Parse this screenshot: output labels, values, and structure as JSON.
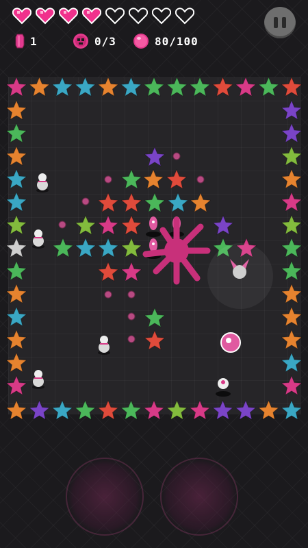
{
  "hud": {
    "hearts": [
      {
        "state": "full"
      },
      {
        "state": "full"
      },
      {
        "state": "full"
      },
      {
        "state": "full"
      },
      {
        "state": "empty"
      },
      {
        "state": "empty"
      },
      {
        "state": "empty"
      },
      {
        "state": "empty"
      }
    ],
    "gems": "1",
    "enemies": "0/3",
    "energy": "80/100",
    "colors": {
      "heart_full": "#f0318c",
      "heart_empty": "#1b1a1d",
      "gem": "#e23a8f",
      "energy": "#e43a8d",
      "pink": "#e05aa0"
    }
  },
  "star_colors": [
    "#d83a87",
    "#e6832f",
    "#3aa7c4",
    "#4bb75a",
    "#7a44c7",
    "#e04b3b",
    "#83bb3d",
    "#cfcfcf",
    "#2e98b8"
  ],
  "controls": {
    "pause_icon": "pause-icon",
    "left_pad": "move-pad-left-icon",
    "right_pad": "move-pad-right-icon"
  }
}
